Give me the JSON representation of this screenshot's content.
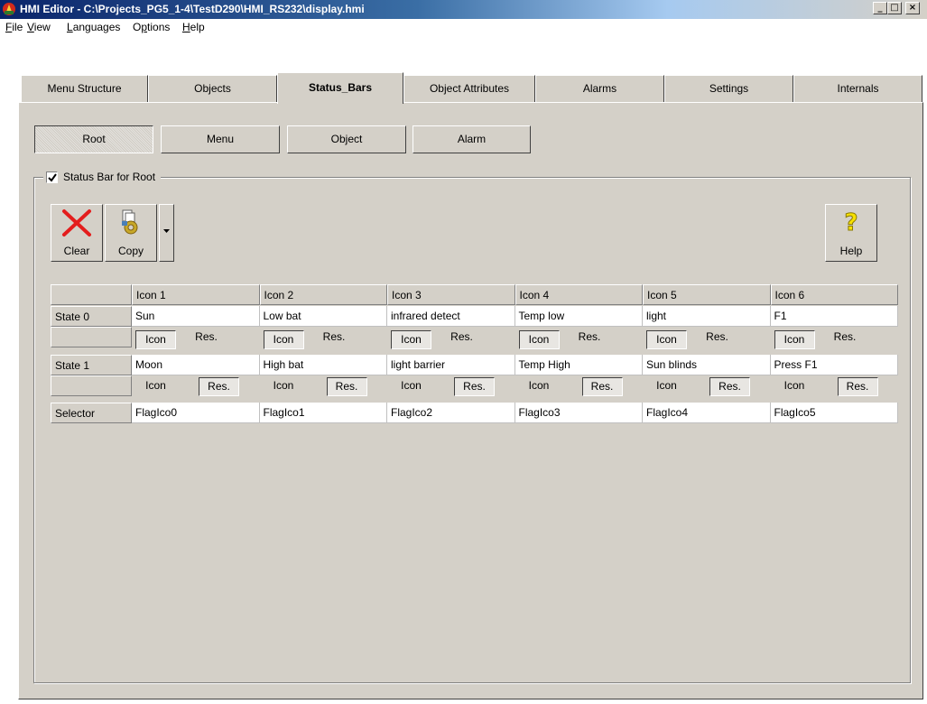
{
  "window": {
    "title": "HMI Editor - C:\\Projects_PG5_1-4\\TestD290\\HMI_RS232\\display.hmi",
    "minimize_label": "_",
    "maximize_label": "□",
    "close_label": "×"
  },
  "menu": [
    {
      "label": "File",
      "accel": "F",
      "rest": "ile"
    },
    {
      "label": "View",
      "accel": "V",
      "rest": "iew"
    },
    {
      "label": "Languages",
      "accel": "L",
      "rest": "anguages"
    },
    {
      "label": "Options",
      "pre": "O",
      "accel": "p",
      "rest": "tions"
    },
    {
      "label": "Help",
      "accel": "H",
      "rest": "elp"
    }
  ],
  "tabs": [
    {
      "label": "Menu Structure"
    },
    {
      "label": "Objects"
    },
    {
      "label": "Status_Bars",
      "active": true
    },
    {
      "label": "Object Attributes"
    },
    {
      "label": "Alarms"
    },
    {
      "label": "Settings"
    },
    {
      "label": "Internals"
    }
  ],
  "sub_buttons": [
    "Root",
    "Menu",
    "Object",
    "Alarm"
  ],
  "group": {
    "title": "Status Bar for Root",
    "checked": true
  },
  "toolbar": {
    "clear_label": "Clear",
    "copy_label": "Copy",
    "help_label": "Help",
    "help_glyph": "?"
  },
  "table": {
    "columns": [
      "Icon 1",
      "Icon 2",
      "Icon 3",
      "Icon 4",
      "Icon 5",
      "Icon 6"
    ],
    "row_labels": {
      "state0": "State 0",
      "state1": "State 1",
      "selector": "Selector"
    },
    "state0": [
      "Sun",
      "Low bat",
      "infrared detect",
      "Temp low",
      "light",
      "F1"
    ],
    "state1": [
      "Moon",
      "High bat",
      "light barrier",
      "Temp High",
      "Sun blinds",
      "Press F1"
    ],
    "selector": [
      "FlagIco0",
      "FlagIco1",
      "FlagIco2",
      "FlagIco3",
      "FlagIco4",
      "FlagIco5"
    ],
    "icon_label": "Icon",
    "res_label": "Res."
  }
}
